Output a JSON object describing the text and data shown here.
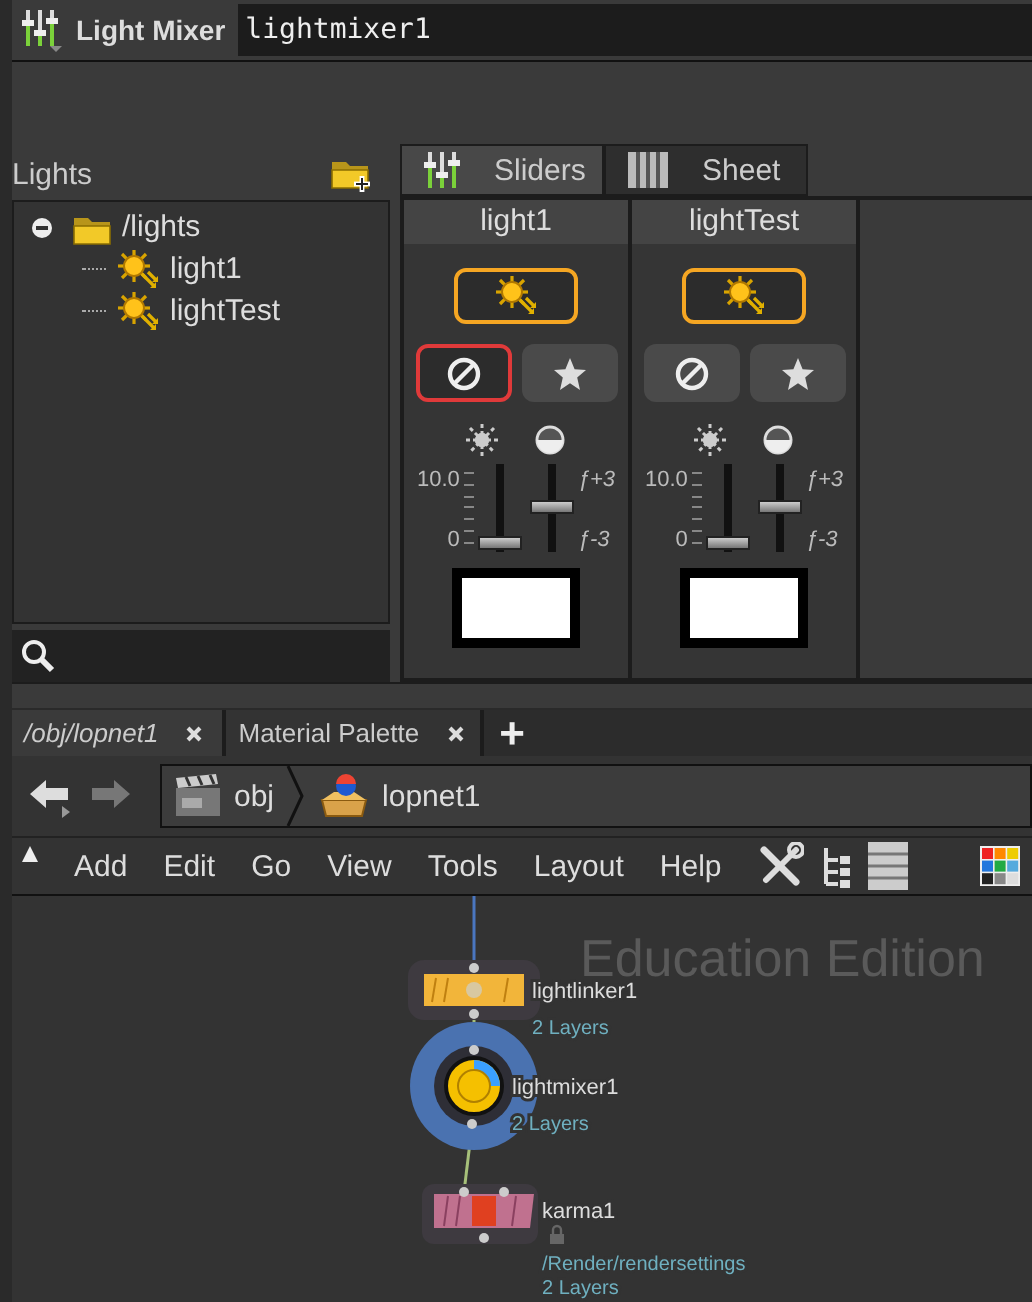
{
  "header": {
    "title": "Light Mixer",
    "node_name": "lightmixer1"
  },
  "lights_panel": {
    "title": "Lights",
    "tree": [
      {
        "label": "/lights",
        "expanded": true,
        "children": [
          {
            "label": "light1"
          },
          {
            "label": "lightTest"
          }
        ]
      }
    ]
  },
  "mixer_tabs": [
    {
      "label": "Sliders",
      "selected": true
    },
    {
      "label": "Sheet",
      "selected": false
    }
  ],
  "light_strips": [
    {
      "name": "light1",
      "enabled": true,
      "muted": true,
      "solo": false,
      "intensity": {
        "max_label": "10.0",
        "min_label": "0",
        "level": 0
      },
      "exposure": {
        "max_label": "ƒ+3",
        "min_label": "ƒ-3",
        "level": 0.5
      },
      "color": "#ffffff"
    },
    {
      "name": "lightTest",
      "enabled": true,
      "muted": false,
      "solo": false,
      "intensity": {
        "max_label": "10.0",
        "min_label": "0",
        "level": 0
      },
      "exposure": {
        "max_label": "ƒ+3",
        "min_label": "ƒ-3",
        "level": 0.5
      },
      "color": "#ffffff"
    }
  ],
  "pane_tabs": [
    {
      "label": "/obj/lopnet1",
      "selected": true
    },
    {
      "label": "Material Palette",
      "selected": false
    }
  ],
  "add_tab": "+",
  "path": [
    "obj",
    "lopnet1"
  ],
  "menu": [
    "Add",
    "Edit",
    "Go",
    "View",
    "Tools",
    "Layout",
    "Help"
  ],
  "network": {
    "watermark": "Education Edition",
    "nodes": [
      {
        "kind": "lightlinker",
        "name": "lightlinker1",
        "selected": false,
        "info": [
          "2 Layers"
        ]
      },
      {
        "kind": "lightmixer",
        "name": "lightmixer1",
        "selected": true,
        "info": [
          "2 Layers"
        ]
      },
      {
        "kind": "karma",
        "name": "karma1",
        "selected": false,
        "locked": true,
        "info": [
          "/Render/rendersettings",
          "2 Layers"
        ]
      }
    ]
  }
}
